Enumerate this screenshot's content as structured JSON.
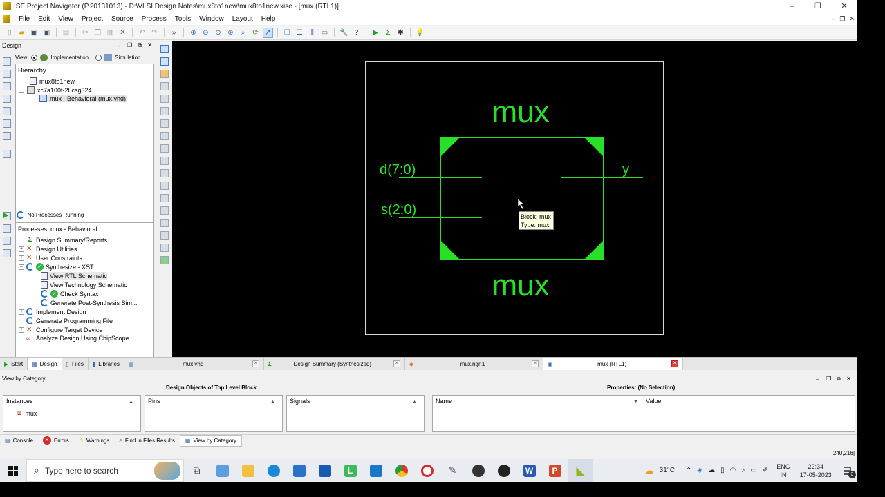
{
  "window": {
    "title": "ISE Project Navigator (P.20131013) - D:\\VLSI Design Notes\\mux8to1new\\mux8to1new.xise - [mux (RTL1)]",
    "controls": [
      "–",
      "❐",
      "✕"
    ]
  },
  "menu": {
    "items": [
      "File",
      "Edit",
      "View",
      "Project",
      "Source",
      "Process",
      "Tools",
      "Window",
      "Layout",
      "Help"
    ],
    "mdi_controls": [
      "–",
      "❐",
      "✕"
    ]
  },
  "design_panel": {
    "header": "Design",
    "header_controls": "↔ ❐ ⧉ ✕",
    "view_label": "View:",
    "view_options": [
      {
        "label": "Implementation",
        "selected": true
      },
      {
        "label": "Simulation",
        "selected": false
      }
    ],
    "hierarchy_title": "Hierarchy",
    "hierarchy": [
      {
        "label": "mux8to1new",
        "depth": 0
      },
      {
        "label": "xc7a100t-2Lcsg324",
        "depth": 0
      },
      {
        "label": "mux - Behavioral (mux.vhd)",
        "depth": 1
      }
    ],
    "process_status": "No Processes Running",
    "processes_title": "Processes: mux - Behavioral",
    "processes": [
      {
        "label": "Design Summary/Reports",
        "depth": 1,
        "icon": "sigma-icon",
        "expand": false
      },
      {
        "label": "Design Utilities",
        "depth": 1,
        "icon": "tools-icon",
        "expand": true
      },
      {
        "label": "User Constraints",
        "depth": 1,
        "icon": "tools-icon",
        "expand": true
      },
      {
        "label": "Synthesize - XST",
        "depth": 1,
        "icon": "sync-ok-icon",
        "expand": true,
        "open": true
      },
      {
        "label": "View RTL Schematic",
        "depth": 2,
        "icon": "doc-icon",
        "selected": true
      },
      {
        "label": "View Technology Schematic",
        "depth": 2,
        "icon": "doc-icon"
      },
      {
        "label": "Check Syntax",
        "depth": 2,
        "icon": "sync-ok-icon"
      },
      {
        "label": "Generate Post-Synthesis Sim...",
        "depth": 2,
        "icon": "sync-icon"
      },
      {
        "label": "Implement Design",
        "depth": 1,
        "icon": "sync-icon",
        "expand": true
      },
      {
        "label": "Generate Programming File",
        "depth": 1,
        "icon": "sync-icon",
        "expand": false
      },
      {
        "label": "Configure Target Device",
        "depth": 1,
        "icon": "tools-icon",
        "expand": true
      },
      {
        "label": "Analyze Design Using ChipScope",
        "depth": 1,
        "icon": "chipscope-icon",
        "expand": false
      }
    ]
  },
  "schematic": {
    "block_name_top": "mux",
    "block_name_bottom": "mux",
    "ports_left": [
      "d(7:0)",
      "s(2:0)"
    ],
    "ports_right": [
      "y"
    ],
    "tooltip_line1": "Block: mux",
    "tooltip_line2": "Type: mux",
    "accent": "#27e027"
  },
  "doc_tabs": {
    "left_tabs": [
      "Start",
      "Design",
      "Files",
      "Libraries"
    ],
    "files": [
      {
        "label": "mux.vhd",
        "active": false
      },
      {
        "label": "Design Summary (Synthesized)",
        "active": false
      },
      {
        "label": "mux.ngr:1",
        "active": false
      },
      {
        "label": "mux (RTL1)",
        "active": true
      }
    ]
  },
  "category_panel": {
    "header": "View by Category",
    "header_controls": "↔ ❐ ⧉ ✕",
    "objects_title": "Design Objects of Top Level Block",
    "properties_title": "Properties: (No Selection)",
    "instances_header": "Instances",
    "instances": [
      "mux"
    ],
    "pins_header": "Pins",
    "signals_header": "Signals",
    "prop_name_header": "Name",
    "prop_value_header": "Value"
  },
  "console_tabs": [
    {
      "label": "Console",
      "active": false
    },
    {
      "label": "Errors",
      "active": false
    },
    {
      "label": "Warnings",
      "active": false
    },
    {
      "label": "Find in Files Results",
      "active": false
    },
    {
      "label": "View by Category",
      "active": true
    }
  ],
  "status": {
    "coordinates": "[240,216]"
  },
  "taskbar": {
    "search_placeholder": "Type here to search",
    "weather": "31°C",
    "language_line1": "ENG",
    "language_line2": "IN",
    "time": "22:34",
    "date": "17-05-2023",
    "notifications": "3"
  }
}
